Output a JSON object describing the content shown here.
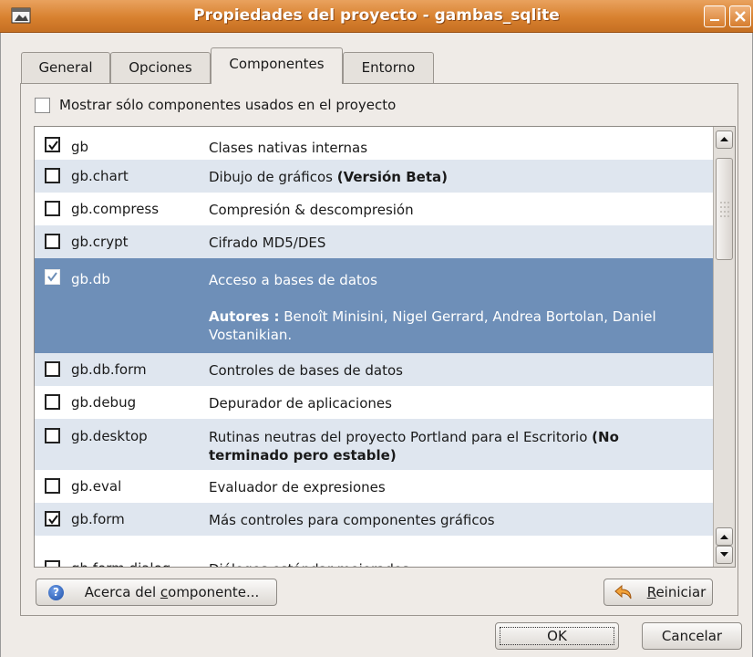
{
  "window": {
    "title": "Propiedades del proyecto - gambas_sqlite"
  },
  "tabs": [
    {
      "label": "General"
    },
    {
      "label": "Opciones"
    },
    {
      "label": "Componentes",
      "active": true
    },
    {
      "label": "Entorno"
    }
  ],
  "filter": {
    "label": "Mostrar sólo componentes usados en el proyecto",
    "checked": false
  },
  "components": [
    {
      "name": "gb",
      "desc": "Clases nativas internas",
      "checked": true
    },
    {
      "name": "gb.chart",
      "desc": "Dibujo de gráficos ",
      "desc_bold": "(Versión Beta)",
      "checked": false
    },
    {
      "name": "gb.compress",
      "desc": "Compresión & descompresión",
      "checked": false
    },
    {
      "name": "gb.crypt",
      "desc": "Cifrado MD5/DES",
      "checked": false
    },
    {
      "name": "gb.db",
      "desc": "Acceso a bases de datos",
      "checked": true,
      "selected": true,
      "authors_label": "Autores :",
      "authors": " Benoît Minisini, Nigel Gerrard, Andrea Bortolan, Daniel Vostanikian."
    },
    {
      "name": "gb.db.form",
      "desc": "Controles de bases de datos",
      "checked": false
    },
    {
      "name": "gb.debug",
      "desc": "Depurador de aplicaciones",
      "checked": false
    },
    {
      "name": "gb.desktop",
      "desc": "Rutinas neutras del proyecto Portland para el Escritorio ",
      "desc_bold": "(No terminado pero estable)",
      "checked": false
    },
    {
      "name": "gb.eval",
      "desc": "Evaluador de expresiones",
      "checked": false
    },
    {
      "name": "gb.form",
      "desc": "Más controles para componentes gráficos",
      "checked": true
    },
    {
      "name": "gb.form.dialog",
      "desc": "Diálogos estándar mejorados",
      "checked": false
    }
  ],
  "buttons": {
    "about_pre": "Acerca del ",
    "about_u": "c",
    "about_post": "omponente...",
    "reset_u": "R",
    "reset_post": "einiciar",
    "ok": "OK",
    "cancel": "Cancelar"
  },
  "colors": {
    "selection": "#6e8fb8",
    "alt_row": "#dfe6ef",
    "titlebar": "#d8812f"
  }
}
